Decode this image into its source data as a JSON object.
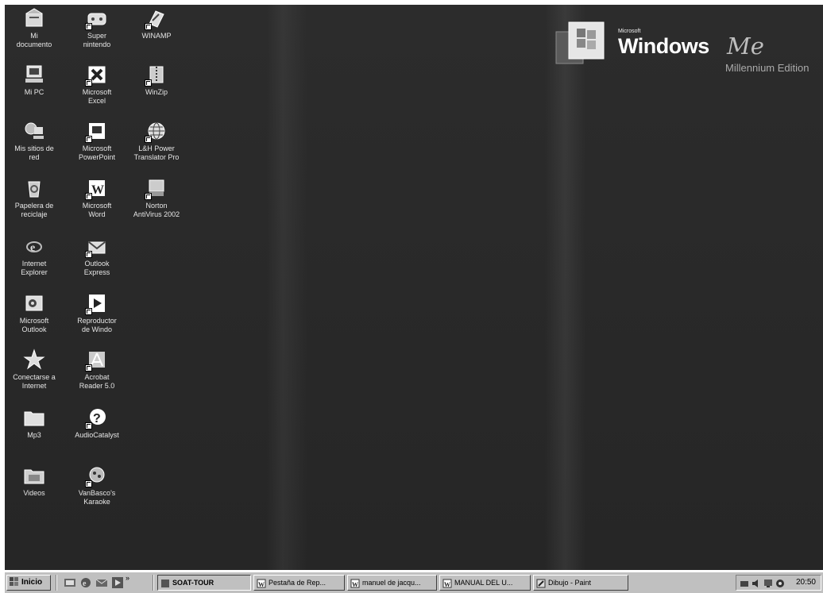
{
  "desktop": {
    "icons": [
      {
        "label": "Mi\ndocumento",
        "icon": "my-documents-icon"
      },
      {
        "label": "Mi PC",
        "icon": "my-computer-icon"
      },
      {
        "label": "Mis sitios de\nred",
        "icon": "network-places-icon"
      },
      {
        "label": "Papelera de\nreciclaje",
        "icon": "recycle-bin-icon"
      },
      {
        "label": "Internet\nExplorer",
        "icon": "internet-explorer-icon"
      },
      {
        "label": "Microsoft\nOutlook",
        "icon": "outlook-icon"
      },
      {
        "label": "Conectarse a\nInternet",
        "icon": "connect-internet-icon"
      },
      {
        "label": "Mp3",
        "icon": "folder-icon"
      },
      {
        "label": "Videos",
        "icon": "folder-icon"
      },
      {
        "label": "Super\nnintendo",
        "icon": "snes-emulator-icon"
      },
      {
        "label": "Microsoft\nExcel",
        "icon": "excel-icon"
      },
      {
        "label": "Microsoft\nPowerPoint",
        "icon": "powerpoint-icon"
      },
      {
        "label": "Microsoft\nWord",
        "icon": "word-icon"
      },
      {
        "label": "Outlook\nExpress",
        "icon": "outlook-express-icon"
      },
      {
        "label": "Reproductor\nde Windo",
        "icon": "media-player-icon"
      },
      {
        "label": "Acrobat\nReader 5.0",
        "icon": "acrobat-icon"
      },
      {
        "label": "AudioCatalyst",
        "icon": "audiocatalyst-icon"
      },
      {
        "label": "VanBasco's\nKaraoke",
        "icon": "karaoke-icon"
      },
      {
        "label": "WINAMP",
        "icon": "winamp-icon"
      },
      {
        "label": "WinZip",
        "icon": "winzip-icon"
      },
      {
        "label": "L&H Power\nTranslator Pro",
        "icon": "globe-icon"
      },
      {
        "label": "Norton\nAntiVirus 2002",
        "icon": "norton-icon"
      }
    ],
    "logo": {
      "brand": "Microsoft",
      "product": "Windows",
      "version": "Me",
      "edition": "Millennium Edition"
    }
  },
  "taskbar": {
    "start_label": "Inicio",
    "quick_launch": [
      "desktop-icon",
      "ie-icon",
      "outlook-express-icon",
      "media-player-icon"
    ],
    "tasks": [
      {
        "label": "SOAT-TOUR"
      },
      {
        "label": "Pestaña de Rep..."
      },
      {
        "label": "manuel de jacqu..."
      },
      {
        "label": "MANUAL DEL U..."
      },
      {
        "label": "Dibujo - Paint"
      }
    ],
    "clock": "20:50"
  }
}
